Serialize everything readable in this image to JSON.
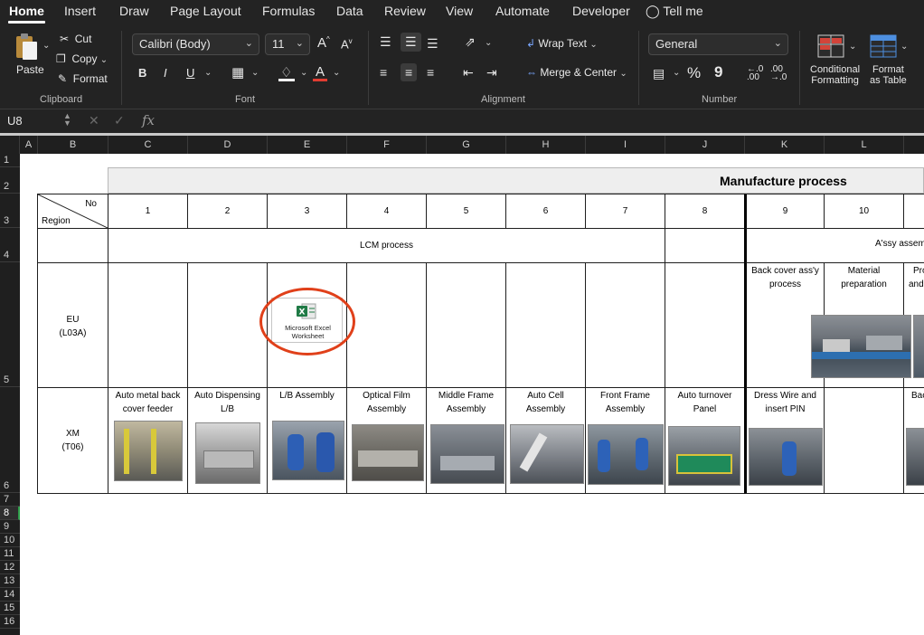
{
  "ribbon": {
    "tabs": [
      "Home",
      "Insert",
      "Draw",
      "Page Layout",
      "Formulas",
      "Data",
      "Review",
      "View",
      "Automate",
      "Developer",
      "Tell me"
    ],
    "clipboard": {
      "paste": "Paste",
      "cut": "Cut",
      "copy": "Copy",
      "format": "Format",
      "group": "Clipboard"
    },
    "font": {
      "name": "Calibri (Body)",
      "size": "11",
      "group": "Font",
      "bold": "B",
      "italic": "I",
      "underline": "U",
      "font_color": "#e03c31"
    },
    "alignment": {
      "wrap": "Wrap Text",
      "merge": "Merge & Center",
      "group": "Alignment"
    },
    "number": {
      "format": "General",
      "percent": "%",
      "comma": "9",
      "group": "Number"
    },
    "styles": {
      "conditional": [
        "Conditional",
        "Formatting"
      ],
      "table": [
        "Format",
        "as Table"
      ]
    }
  },
  "formula_bar": {
    "cell_ref": "U8",
    "fx": "fx",
    "value": ""
  },
  "columns": [
    "A",
    "B",
    "C",
    "D",
    "E",
    "F",
    "G",
    "H",
    "I",
    "J",
    "K",
    "L"
  ],
  "rows": [
    "1",
    "2",
    "3",
    "4",
    "5",
    "6",
    "7",
    "8",
    "9",
    "10",
    "11",
    "12",
    "13",
    "14",
    "15",
    "16"
  ],
  "selected_row": "8",
  "sheet": {
    "title": "Manufacture process",
    "corner_no": "No",
    "corner_region": "Region",
    "numbers": [
      "1",
      "2",
      "3",
      "4",
      "5",
      "6",
      "7",
      "8",
      "9",
      "10"
    ],
    "lcm_process": "LCM process",
    "assy_process": "A'ssy assemb",
    "eu_region": [
      "EU",
      "(L03A)"
    ],
    "xm_region": [
      "XM",
      "(T06)"
    ],
    "eu_steps": {
      "k": [
        "Back cover ass'y",
        "process"
      ],
      "l": [
        "Material",
        "preparation"
      ],
      "m": [
        "Pro",
        "and"
      ]
    },
    "embedded_object": {
      "name": [
        "Microsoft Excel",
        "Worksheet"
      ],
      "icon": "excel-icon"
    },
    "xm_steps": [
      [
        "Auto metal back",
        "cover feeder"
      ],
      [
        "Auto Dispensing",
        "L/B"
      ],
      [
        "L/B Assembly",
        ""
      ],
      [
        "Optical Film",
        "Assembly"
      ],
      [
        "Middle Frame",
        "Assembly"
      ],
      [
        "Auto Cell",
        "Assembly"
      ],
      [
        "Front Frame",
        "Assembly"
      ],
      [
        "Auto turnover",
        "Panel"
      ],
      [
        "Dress Wire and",
        "insert PIN"
      ],
      [
        "",
        ""
      ],
      [
        "Bac",
        ""
      ]
    ],
    "highlight_color": "#e0401a"
  }
}
